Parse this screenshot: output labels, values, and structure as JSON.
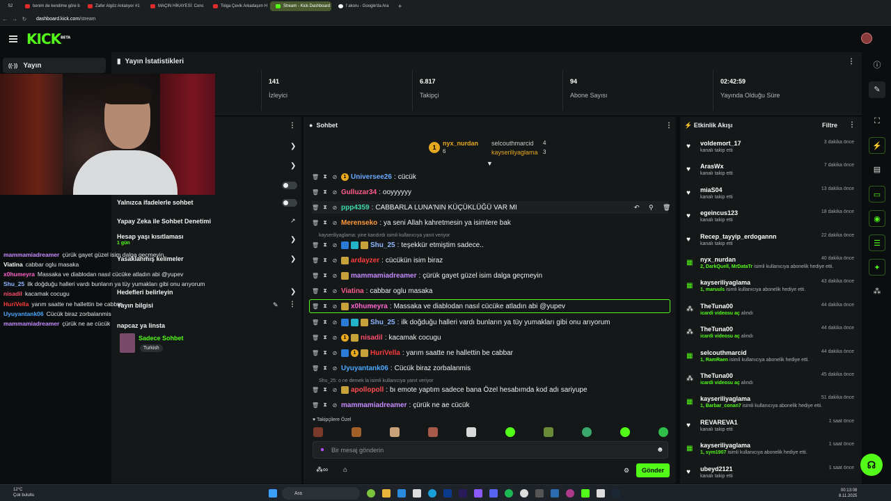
{
  "browser": {
    "tabs": [
      {
        "label": "benim de kendime göre b"
      },
      {
        "label": "Zafer Algöz Anlatıyor #1"
      },
      {
        "label": "MAÇIN HİKAYESİ: Conc"
      },
      {
        "label": "Tolga Çevik Arkadaşım H"
      },
      {
        "label": "Stream - Kick Dashboard"
      },
      {
        "label": "f akoru - Google'da Ara"
      }
    ],
    "url_host": "dashboard.kick.com",
    "url_path": "/stream",
    "tab_count": "52"
  },
  "header": {
    "logo": "KICK",
    "logo_tag": "BETA"
  },
  "sidebar": {
    "section": "Yayın"
  },
  "stats": {
    "title": "Yayın İstatistikleri",
    "items": [
      {
        "value": "141",
        "label": "İzleyici"
      },
      {
        "value": "6.817",
        "label": "Takipçi"
      },
      {
        "value": "94",
        "label": "Abone Sayısı"
      },
      {
        "value": "02:42:59",
        "label": "Yayında Olduğu Süre"
      }
    ]
  },
  "mod_panel": {
    "rows": [
      "Yalnızca ifadelerle sohbet",
      "Yapay Zeka ile Sohbet Denetimi",
      "Hesap yaşı kısıtlaması",
      "1 gün",
      "Yasaklanmış kelimeler",
      "Hedefleri belirleyin"
    ],
    "info_title": "Yayın bilgisi",
    "stream_title": "napcaz ya linsta",
    "category": "Sadece Sohbet",
    "tag": "Turkish"
  },
  "overlay_chat": [
    {
      "user": "mammamiadreamer",
      "text": "çürük gayet güzel isim dalga geçmeyin",
      "color": "#c58bff"
    },
    {
      "user": "Viatina",
      "text": "cabbar oglu masaka",
      "color": "#ffffff"
    },
    {
      "user": "x0humeyra",
      "text": "Massaka ve diablodan nasıl cücüke atladın abi @yupev",
      "color": "#ff66cc"
    },
    {
      "user": "Shu_25",
      "text": "ilk doğduğu halleri vardı bunların ya tüy yumakları gibi onu arıyorum",
      "color": "#8fb7ff"
    },
    {
      "user": "nisadil",
      "text": "kacamak cocugu",
      "color": "#ff4d6d"
    },
    {
      "user": "HuriVella",
      "text": "yarım saatte ne hallettin be cabbar",
      "color": "#ff3b3b"
    },
    {
      "user": "Uyuyantank06",
      "text": "Cücük biraz zorbalanmis",
      "color": "#4aa8ff"
    },
    {
      "user": "mammamiadreamer",
      "text": "çürük ne ae cücük",
      "color": "#c58bff"
    }
  ],
  "chat": {
    "title": "Sohbet",
    "top_gifters": [
      {
        "name": "nyx_nurdan",
        "count": "6"
      },
      {
        "name": "selcouthmarcid",
        "count": "4"
      },
      {
        "name": "kayseriliyaglama",
        "count": "3"
      }
    ],
    "messages": [
      {
        "user": "Universee26",
        "text": "cücük",
        "color": "#6aa8ff"
      },
      {
        "user": "Gulluzar34",
        "text": "ooyyyyyy",
        "color": "#ff5c8a"
      },
      {
        "user": "ppp4359",
        "text": "CABBARLA LUNA'NIN KÜÇÜKLÜĞÜ VAR MI",
        "color": "#3fd9a8"
      },
      {
        "user": "Merenseko",
        "text": "ya seni Allah kahretmesin ya isimlere bak",
        "color": "#ff9a3c"
      },
      {
        "user": "Shu_25",
        "text": "teşekkür etmiştim sadece..",
        "color": "#8fb7ff"
      },
      {
        "user": "ardayzer",
        "text": "cücükün isim biraz",
        "color": "#ff3b3b"
      },
      {
        "user": "mammamiadreamer",
        "text": "çürük gayet güzel isim dalga geçmeyin",
        "color": "#c58bff"
      },
      {
        "user": "Viatina",
        "text": "cabbar oglu masaka",
        "color": "#ff5c8a"
      },
      {
        "user": "x0humeyra",
        "text": "Massaka ve diablodan nasıl cücüke atladın abi @yupev",
        "color": "#ff66cc"
      },
      {
        "user": "Shu_25",
        "text": "ilk doğduğu halleri vardı bunların ya tüy yumakları gibi onu arıyorum",
        "color": "#8fb7ff"
      },
      {
        "user": "nisadil",
        "text": "kacamak cocugu",
        "color": "#ff4d6d"
      },
      {
        "user": "HuriVella",
        "text": "yarım saatte ne hallettin be cabbar",
        "color": "#ff3b3b"
      },
      {
        "user": "Uyuyantank06",
        "text": "Cücük biraz zorbalanmis",
        "color": "#4aa8ff"
      },
      {
        "user": "apollopoll",
        "text": "bı emote yaptım sadece bana Özel hesabımda kod adı sariyupe",
        "color": "#ff4d4d"
      },
      {
        "user": "mammamiadreamer",
        "text": "çürük ne ae cücük",
        "color": "#c58bff"
      }
    ],
    "reply1": "kayseriliyaglama: yine kandırdı isimli kullanıcıya yanıt veriyor",
    "reply2": "Shu_25: o ne demek la isimli kullanıcıya yanıt veriyor",
    "emote_label": "Takipçilere Özel",
    "input_placeholder": "Bir mesaj gönderin",
    "send_label": "Gönder"
  },
  "activity": {
    "title": "Etkinlik Akışı",
    "filter": "Filtre",
    "items": [
      {
        "name": "voldemort_17",
        "desc": "kanalı takip etti",
        "time": "3 dakika önce",
        "kind": "follow"
      },
      {
        "name": "ArasWx",
        "desc": "kanalı takip etti",
        "time": "7 dakika önce",
        "kind": "follow"
      },
      {
        "name": "miaS04",
        "desc": "kanalı takip etti",
        "time": "13 dakika önce",
        "kind": "follow"
      },
      {
        "name": "egeincus123",
        "desc": "kanalı takip etti",
        "time": "18 dakika önce",
        "kind": "follow"
      },
      {
        "name": "Recep_tayyip_erdogannn",
        "desc": "kanalı takip etti",
        "time": "22 dakika önce",
        "kind": "follow"
      },
      {
        "name": "nyx_nurdan",
        "hl": "2, DarkQuell, MrDataTr",
        "desc": "isimli kullanıcıya abonelik hediye etti.",
        "time": "40 dakika önce",
        "kind": "gift"
      },
      {
        "name": "kayseriliyaglama",
        "hl": "1, maruuls",
        "desc": "isimli kullanıcıya abonelik hediye etti.",
        "time": "43 dakika önce",
        "kind": "gift"
      },
      {
        "name": "TheTuna00",
        "hl": "icardi videosu aç",
        "desc": "alındı",
        "time": "44 dakika önce",
        "kind": "reward"
      },
      {
        "name": "TheTuna00",
        "hl": "icardi videosu aç",
        "desc": "alındı",
        "time": "44 dakika önce",
        "kind": "reward"
      },
      {
        "name": "selcouthmarcid",
        "hl": "1, RamRaen",
        "desc": "isimli kullanıcıya abonelik hediye etti.",
        "time": "44 dakika önce",
        "kind": "gift"
      },
      {
        "name": "TheTuna00",
        "hl": "icardi videosu aç",
        "desc": "alındı",
        "time": "45 dakika önce",
        "kind": "reward"
      },
      {
        "name": "kayseriliyaglama",
        "hl": "1, Barbar_conan7",
        "desc": "isimli kullanıcıya abonelik hediye etti.",
        "time": "51 dakika önce",
        "kind": "gift"
      },
      {
        "name": "REVAREVA1",
        "desc": "kanalı takip etti",
        "time": "1 saat önce",
        "kind": "follow"
      },
      {
        "name": "kayseriliyaglama",
        "hl": "1, sym1907",
        "desc": "isimli kullanıcıya abonelik hediye etti.",
        "time": "1 saat önce",
        "kind": "gift"
      },
      {
        "name": "ubeyd2121",
        "desc": "kanalı takip etti",
        "time": "1 saat önce",
        "kind": "follow"
      }
    ]
  },
  "taskbar": {
    "weather_temp": "12°C",
    "weather_desc": "Çok bulutlu",
    "search": "Ara",
    "time": "00:13:08",
    "date": "8.11.2025"
  }
}
